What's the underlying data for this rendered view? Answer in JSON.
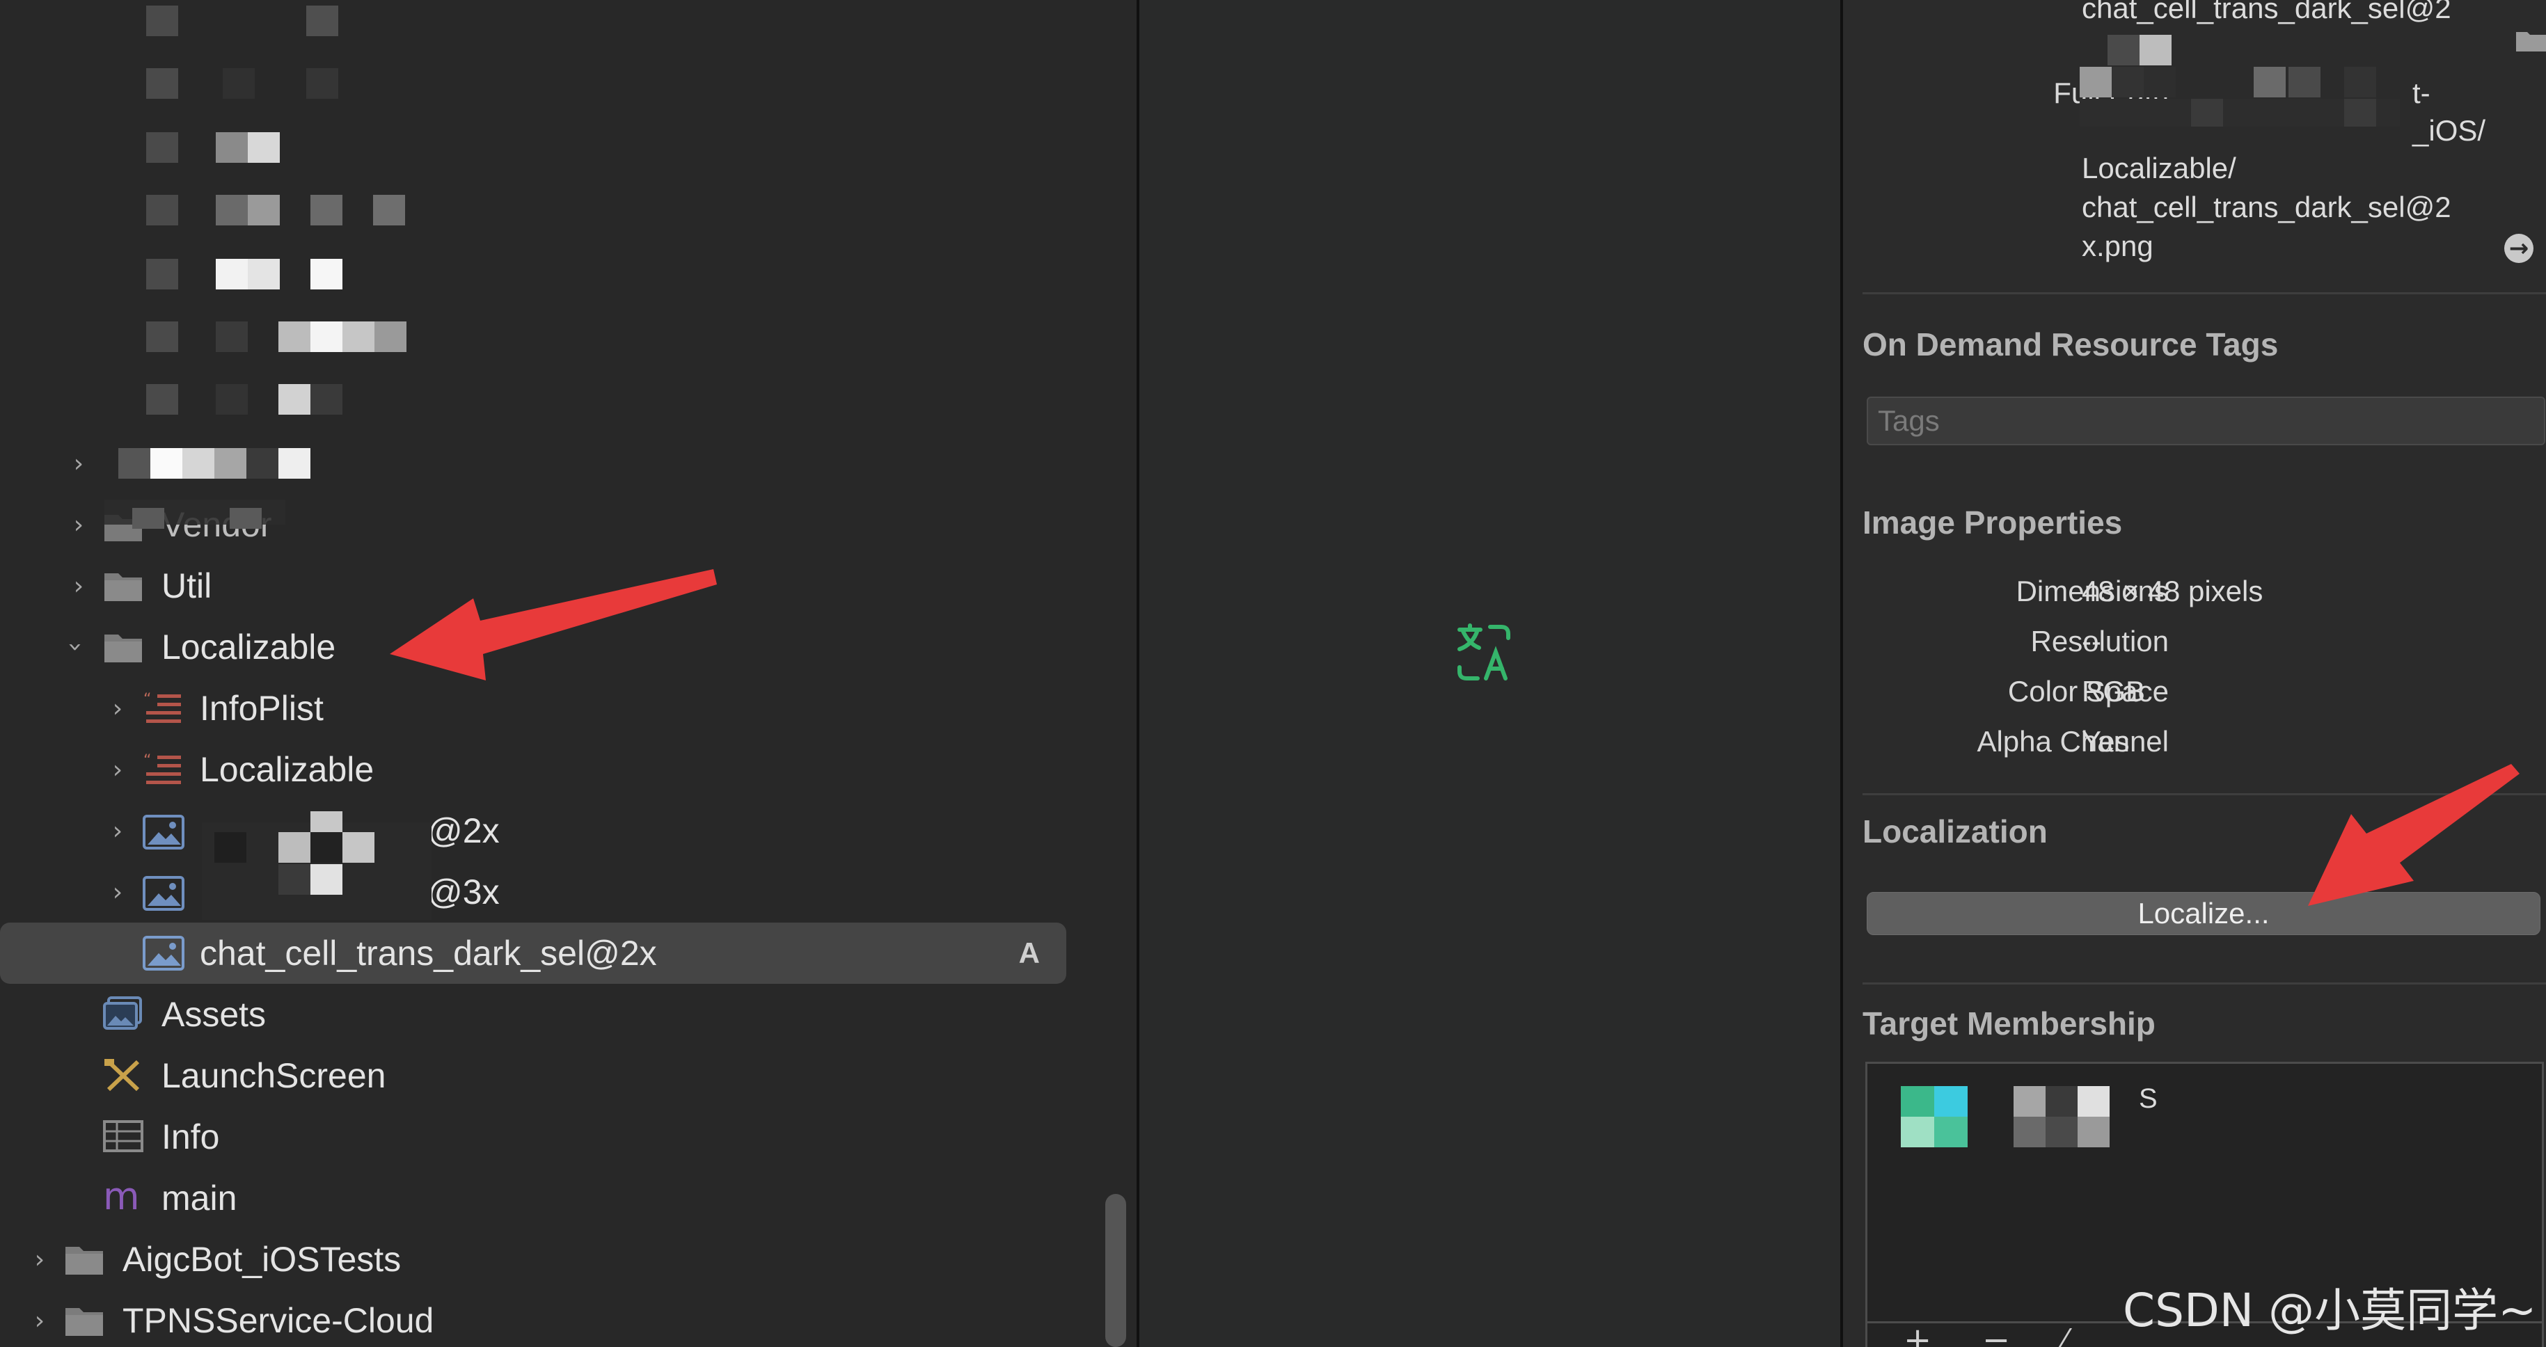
{
  "navigator": {
    "items": [
      {
        "label": "Vendor",
        "expanded": false
      },
      {
        "label": "Util",
        "expanded": false
      },
      {
        "label": "Localizable",
        "expanded": true
      },
      {
        "label": "InfoPlist",
        "expanded": false
      },
      {
        "label": "Localizable",
        "expanded": false
      },
      {
        "label": "@2x",
        "expanded": false
      },
      {
        "label": "@3x",
        "expanded": false
      },
      {
        "label": "chat_cell_trans_dark_sel@2x",
        "badge": "A",
        "selected": true
      },
      {
        "label": "Assets"
      },
      {
        "label": "LaunchScreen"
      },
      {
        "label": "Info"
      },
      {
        "label": "main"
      },
      {
        "label": "AigcBot_iOSTests",
        "expanded": false
      },
      {
        "label": "TPNSService-Cloud",
        "expanded": false
      }
    ]
  },
  "inspector": {
    "full_path": {
      "top_partial": "chat_cell_trans_dark_sel@2",
      "key": "Full Path",
      "lines": [
        "t-",
        "_iOS/",
        "Localizable/",
        "chat_cell_trans_dark_sel@2",
        "x.png"
      ]
    },
    "on_demand": {
      "title": "On Demand Resource Tags",
      "tags_placeholder": "Tags"
    },
    "image_properties": {
      "title": "Image Properties",
      "rows": [
        {
          "key": "Dimensions",
          "value": "48 × 48 pixels"
        },
        {
          "key": "Resolution",
          "value": "--"
        },
        {
          "key": "Color Space",
          "value": "RGB"
        },
        {
          "key": "Alpha Channel",
          "value": "Yes"
        }
      ]
    },
    "localization": {
      "title": "Localization",
      "button_label": "Localize..."
    },
    "target_membership": {
      "title": "Target Membership",
      "target_suffix": "S",
      "add": "+",
      "remove": "−"
    }
  },
  "watermark": "CSDN @小莫同学~",
  "colors": {
    "arrow": "#e83a3a",
    "localize_icon": "#35b56b",
    "selection": "#454545"
  }
}
